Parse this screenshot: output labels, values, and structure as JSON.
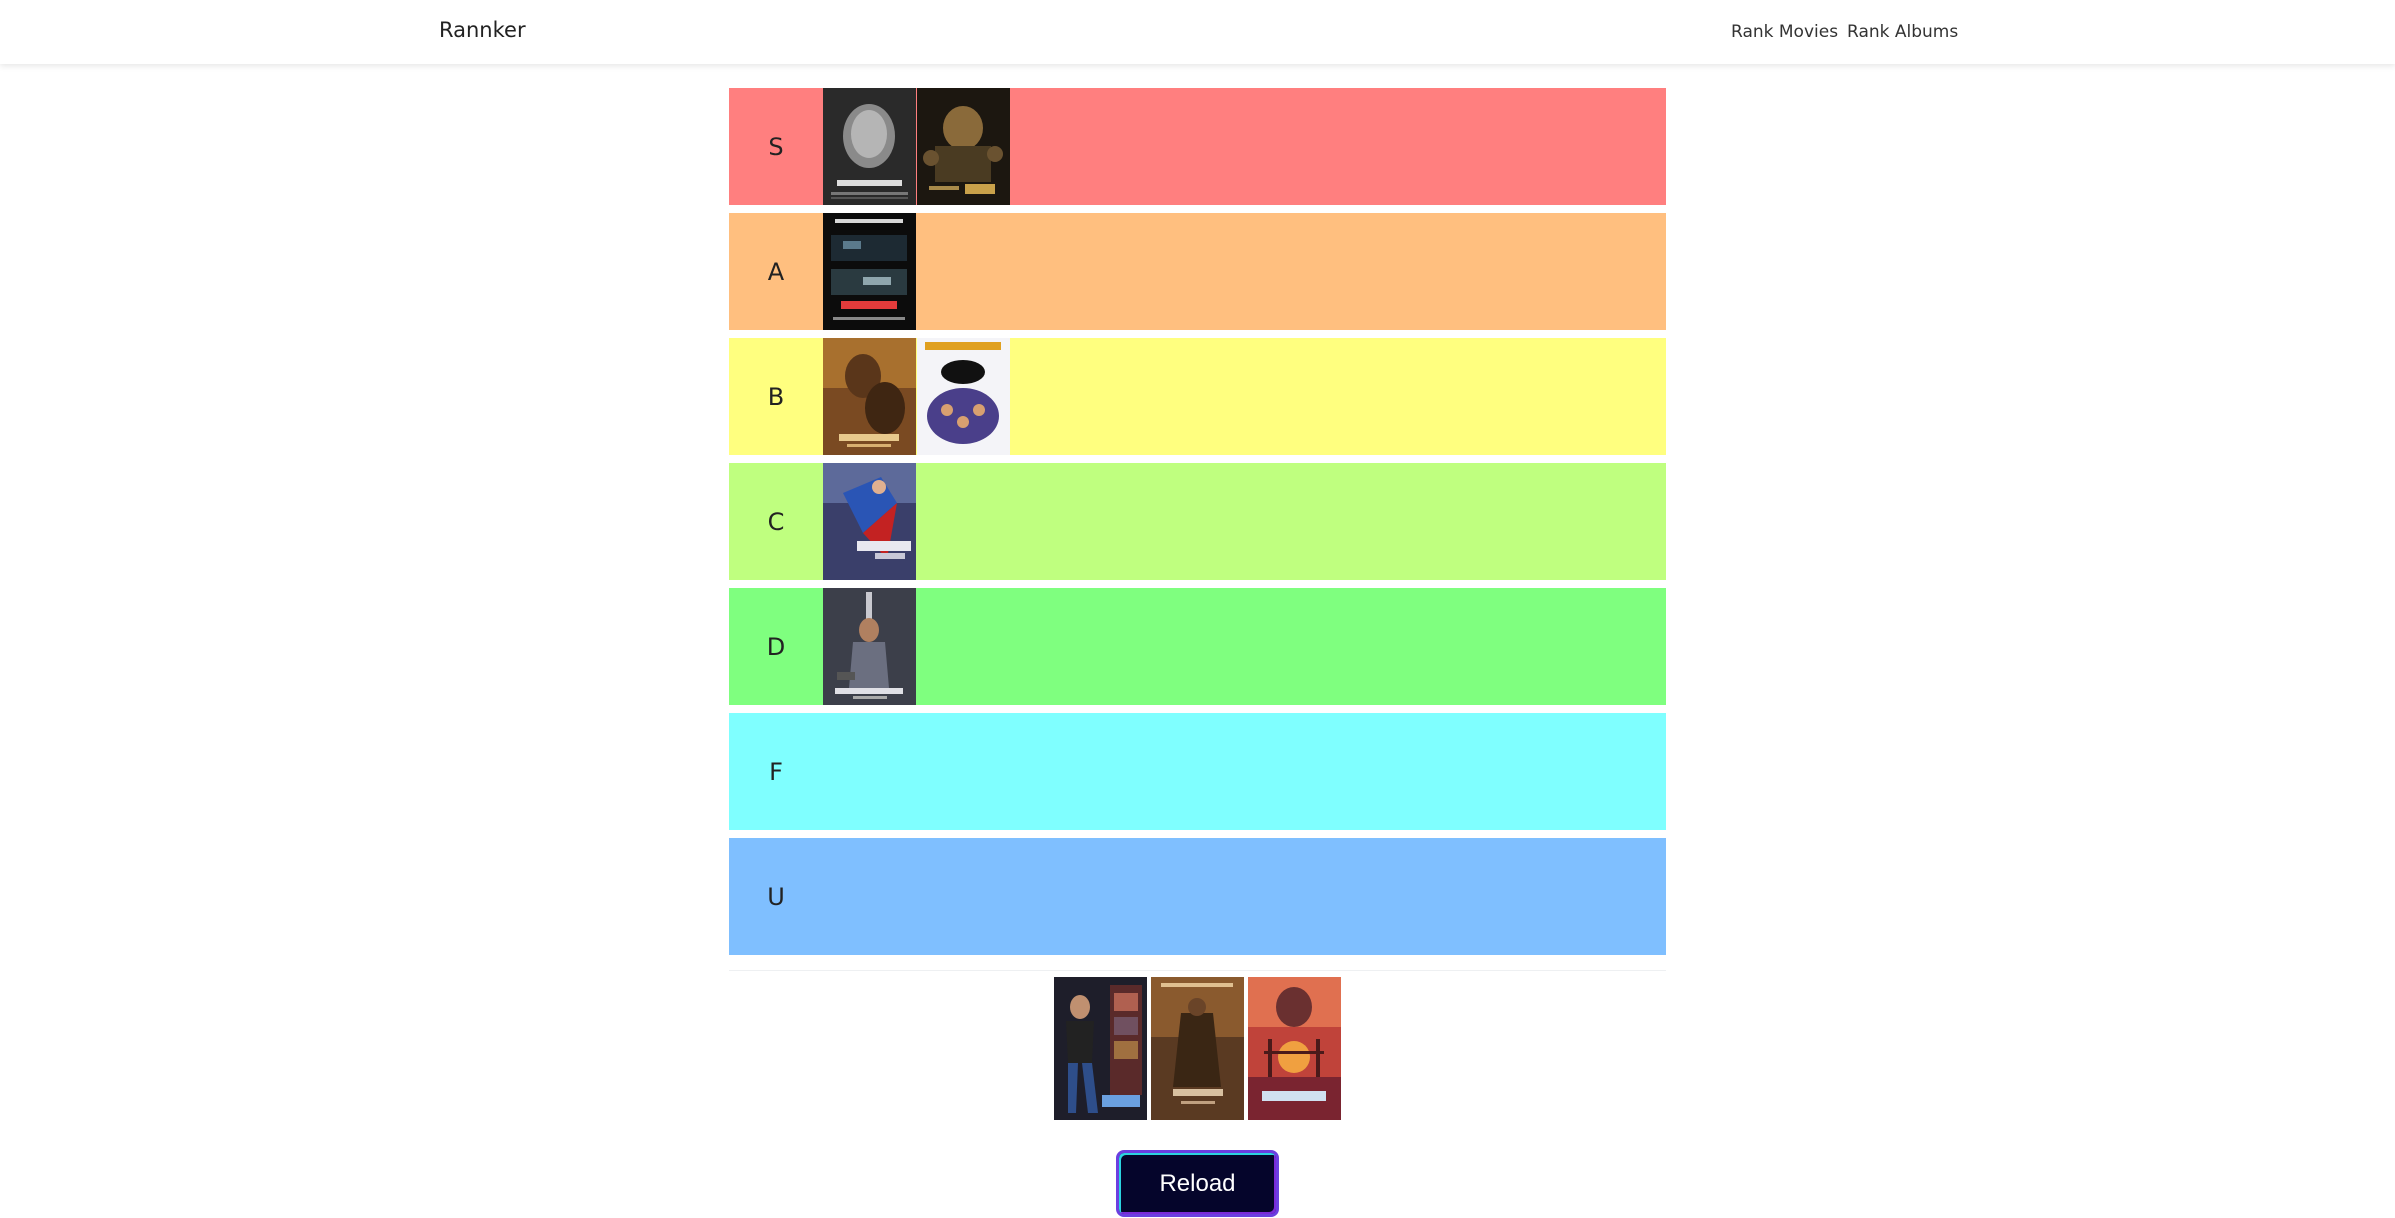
{
  "navbar": {
    "brand": "Rannker",
    "links": [
      "Rank Movies",
      "Rank Albums"
    ]
  },
  "tiers": [
    {
      "label": "S",
      "color": "#ff7f7f",
      "posters": [
        "highlander-poster",
        "godfather-poster"
      ]
    },
    {
      "label": "A",
      "color": "#ffbf7f",
      "posters": [
        "rear-window-poster"
      ]
    },
    {
      "label": "B",
      "color": "#ffff7f",
      "posters": [
        "last-of-the-mohicans-poster",
        "police-academy-poster"
      ]
    },
    {
      "label": "C",
      "color": "#bfff7f",
      "posters": [
        "superman-iv-poster"
      ]
    },
    {
      "label": "D",
      "color": "#7fff7f",
      "posters": [
        "highlander-ii-poster"
      ]
    },
    {
      "label": "F",
      "color": "#7fffff",
      "posters": []
    },
    {
      "label": "U",
      "color": "#7fbfff",
      "posters": []
    }
  ],
  "unranked_pool": [
    "road-house-poster",
    "shawshank-redemption-poster",
    "star-trek-iv-poster"
  ],
  "reload_button": "Reload"
}
